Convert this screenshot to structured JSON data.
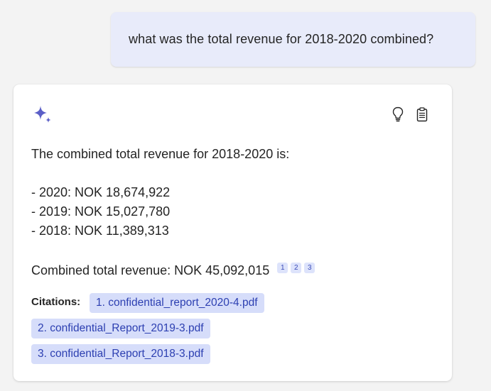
{
  "user_message": {
    "text": "what was the total revenue for 2018-2020 combined?"
  },
  "bot_message": {
    "icon": "sparkle-icon",
    "actions": [
      {
        "name": "lightbulb-icon"
      },
      {
        "name": "clipboard-icon"
      }
    ],
    "intro": "The combined total revenue for 2018-2020 is:",
    "items": [
      "- 2020: NOK 18,674,922",
      "- 2019: NOK 15,027,780",
      "- 2018: NOK 11,389,313"
    ],
    "total": "Combined total revenue: NOK 45,092,015",
    "refs": [
      "1",
      "2",
      "3"
    ],
    "citations_label": "Citations:",
    "citations": [
      "1. confidential_report_2020-4.pdf",
      "2. confidential_Report_2019-3.pdf",
      "3. confidential_Report_2018-3.pdf"
    ]
  },
  "colors": {
    "page_background": "#f3f3f3",
    "user_bubble": "#e8ebfa",
    "citation_chip": "#d6ddfa",
    "citation_text": "#2c3fb1",
    "accent": "#5b5fc7"
  }
}
